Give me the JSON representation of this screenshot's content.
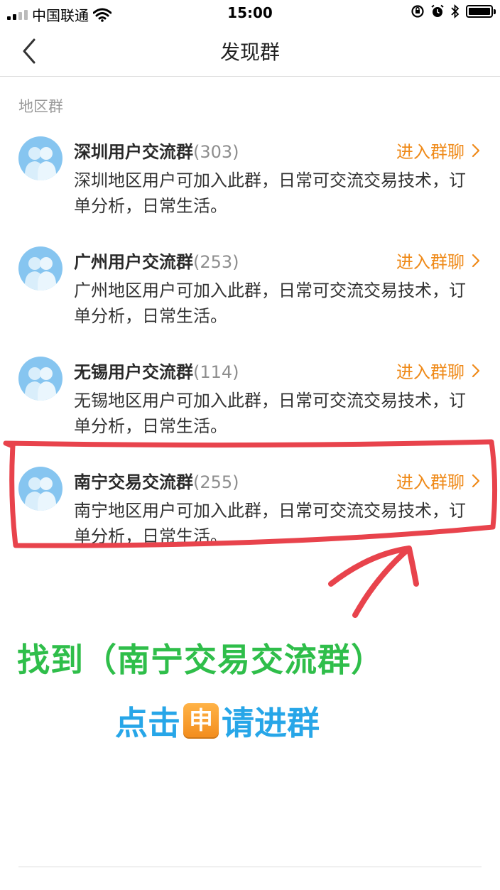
{
  "status_bar": {
    "carrier": "中国联通",
    "time": "15:00",
    "battery_level": 1.0
  },
  "nav": {
    "title": "发现群",
    "back_icon": "chevron-left-icon"
  },
  "section_label": "地区群",
  "groups": [
    {
      "name": "深圳用户交流群",
      "count": "(303)",
      "join_label": "进入群聊",
      "desc": "深圳地区用户可加入此群，日常可交流交易技术，订单分析，日常生活。"
    },
    {
      "name": "广州用户交流群",
      "count": "(253)",
      "join_label": "进入群聊",
      "desc": "广州地区用户可加入此群，日常可交流交易技术，订单分析，日常生活。"
    },
    {
      "name": "无锡用户交流群",
      "count": "(114)",
      "join_label": "进入群聊",
      "desc": "无锡地区用户可加入此群，日常可交流交易技术，订单分析，日常生活。"
    },
    {
      "name": "南宁交易交流群",
      "count": "(255)",
      "join_label": "进入群聊",
      "desc": "南宁地区用户可加入此群，日常可交流交易技术，订单分析，日常生活。"
    }
  ],
  "annotation": {
    "main_text": "找到（南宁交易交流群）",
    "sub_before": "点击",
    "sub_badge": "申",
    "sub_after": "请进群"
  },
  "colors": {
    "accent_orange": "#ef8a19",
    "avatar_blue": "#86c5f0",
    "annotation_red": "#e8434c",
    "annotation_green": "#2fbe4a",
    "annotation_blue": "#27a6e8"
  }
}
